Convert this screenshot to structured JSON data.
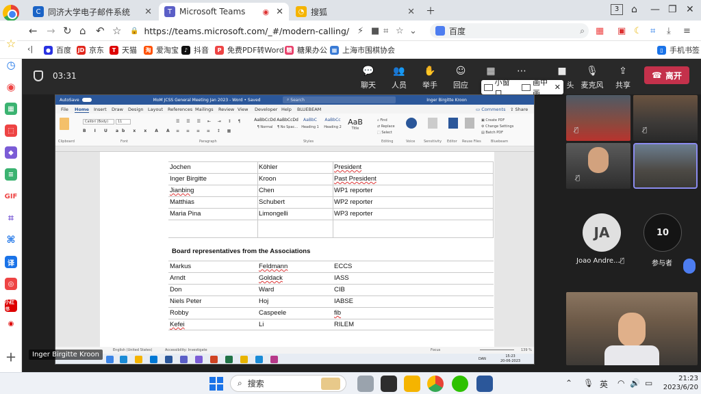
{
  "browser": {
    "tabs": [
      {
        "label": "同济大学电子邮件系统",
        "icon": "mail-icon",
        "active": false
      },
      {
        "label": "Microsoft Teams",
        "icon": "teams-icon",
        "active": true
      },
      {
        "label": "搜狐",
        "icon": "sohu-icon",
        "active": false
      }
    ],
    "tab_count": "3",
    "url": "https://teams.microsoft.com/_#/modern-calling/",
    "search_engine": "百度"
  },
  "bookmarks": [
    {
      "label": "百度",
      "color": "#2932e1"
    },
    {
      "label": "京东",
      "color": "#e1251b"
    },
    {
      "label": "天猫",
      "color": "#d00"
    },
    {
      "label": "爱淘宝",
      "color": "#ff5000"
    },
    {
      "label": "抖音",
      "color": "#111"
    },
    {
      "label": "免费PDF转Word",
      "color": "#e44"
    },
    {
      "label": "糖果办公",
      "color": "#e8416b"
    },
    {
      "label": "上海市围棋协会",
      "color": "#3a7bd5"
    }
  ],
  "bookmarks_right": "手机书签",
  "teams": {
    "timer": "03:31",
    "controls": [
      {
        "label": "聊天",
        "glyph": "💬"
      },
      {
        "label": "人员",
        "glyph": "👥"
      },
      {
        "label": "举手",
        "glyph": "✋"
      },
      {
        "label": "回应",
        "glyph": "☺"
      },
      {
        "label": "视图",
        "glyph": "▦"
      },
      {
        "label": "更多",
        "glyph": "⋯"
      }
    ],
    "camera_label": "摄像头",
    "mic_label": "麦克风",
    "share_label": "共享",
    "leave_label": "离开",
    "tooltip": {
      "mini": "小窗口",
      "pip": "画中画"
    },
    "participants": {
      "ja_initials": "JA",
      "ja_name": "Joao Andre...",
      "count": "10",
      "count_label": "参与者"
    },
    "presenter_name": "Inger Birgitte Kroon"
  },
  "word": {
    "title": "MoM JCSS General Meeting Jan 2023 - Word • Saved",
    "search": "Search",
    "user": "Inger Birgitte Kroon",
    "menu": [
      "File",
      "Home",
      "Insert",
      "Draw",
      "Design",
      "Layout",
      "References",
      "Mailings",
      "Review",
      "View",
      "Developer",
      "Help",
      "BLUEBEAM"
    ],
    "comments": "Comments",
    "share": "Share",
    "styles": [
      {
        "sample": "AaBbCcDd",
        "name": "¶ Normal"
      },
      {
        "sample": "AaBbCcDd",
        "name": "¶ No Spac..."
      },
      {
        "sample": "AaBbC",
        "name": "Heading 1"
      },
      {
        "sample": "AaBbCc",
        "name": "Heading 2"
      },
      {
        "sample": "AaB",
        "name": "Title"
      }
    ],
    "font": "Calibri (Body)",
    "font_size": "11",
    "groups": [
      "Clipboard",
      "Font",
      "Paragraph",
      "Styles",
      "Editing",
      "Voice",
      "Sensitivity",
      "Editor",
      "Reuse Files",
      "Bluebeam"
    ],
    "status_lang": "English (United States)",
    "status_access": "Accessibility: Investigate",
    "status_focus": "Focus",
    "zoom": "139 %",
    "win_time": "15:23",
    "win_date": "20-06-2023",
    "win_lang": "DAN"
  },
  "document": {
    "rows_top": [
      [
        "Jochen",
        "Köhler",
        "President"
      ],
      [
        "Inger Birgitte",
        "Kroon",
        "Past President"
      ],
      [
        "Jianbing",
        "Chen",
        "WP1 reporter"
      ],
      [
        "Matthias",
        "Schubert",
        "WP2 reporter"
      ],
      [
        "Maria Pina",
        "Limongelli",
        "WP3 reporter"
      ]
    ],
    "section_heading": "Board representatives from the Associations",
    "rows_bottom": [
      [
        "Markus",
        "Feldmann",
        "ECCS"
      ],
      [
        "Arndt",
        "Goldack",
        "IASS"
      ],
      [
        "Don",
        "Ward",
        "CIB"
      ],
      [
        "Niels Peter",
        "Hoj",
        "IABSE"
      ],
      [
        "Robby",
        "Caspeele",
        "fib"
      ],
      [
        "Kefei",
        "Li",
        "RILEM"
      ]
    ]
  },
  "taskbar": {
    "search": "搜索",
    "ime": "英",
    "time": "21:23",
    "date": "2023/6/20"
  }
}
